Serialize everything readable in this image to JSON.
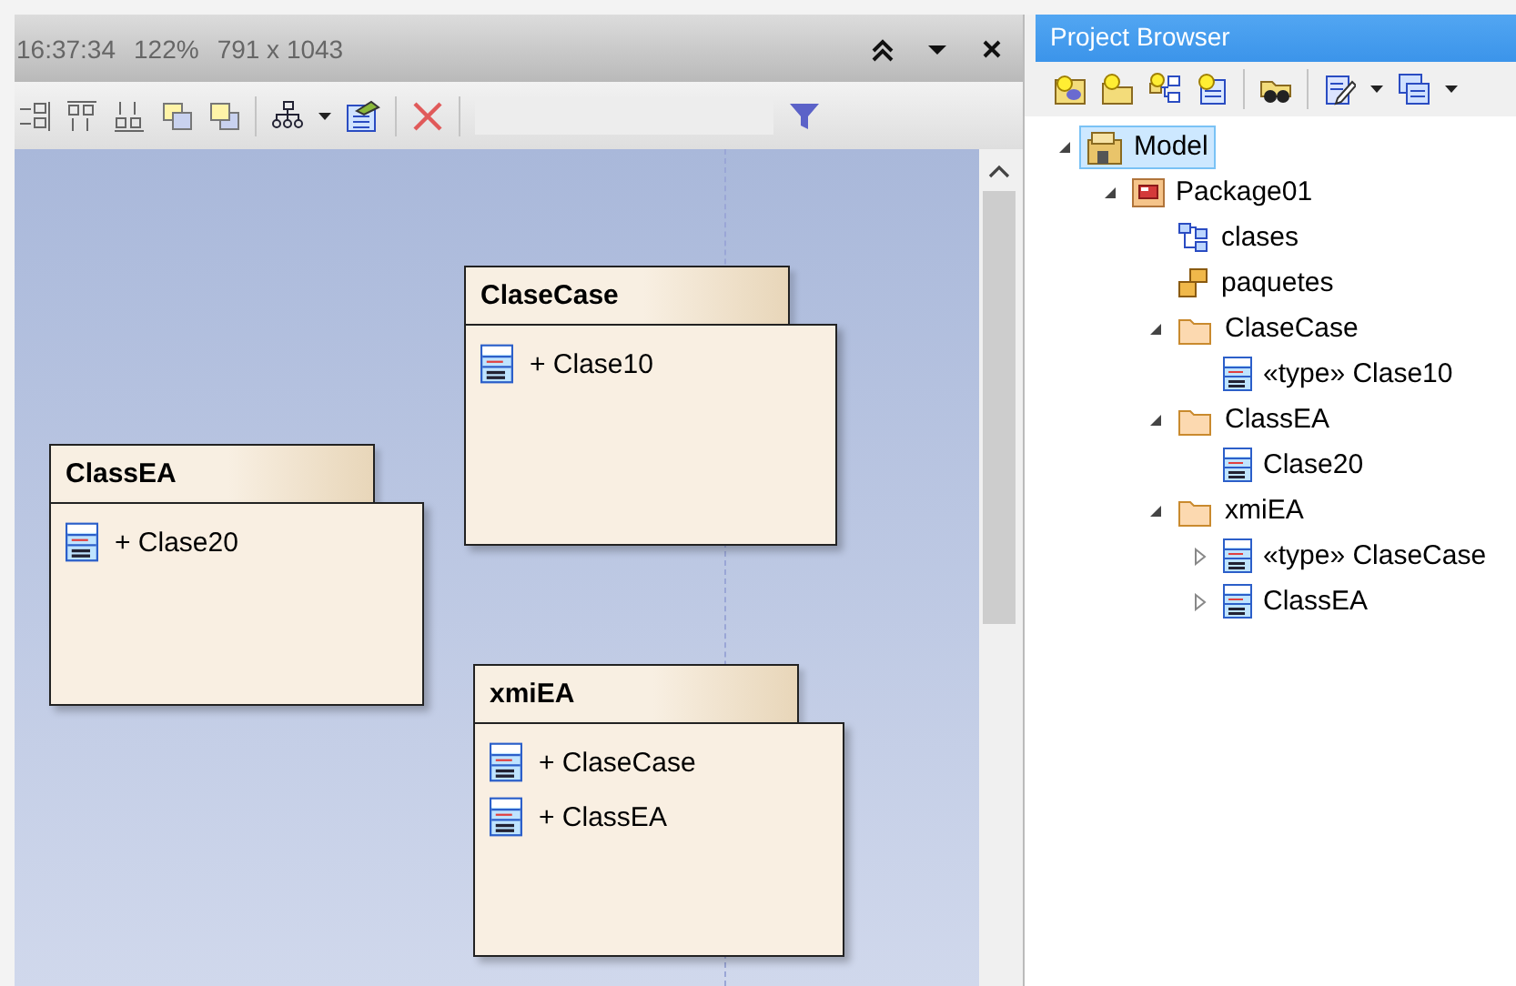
{
  "diagram": {
    "status": [
      "16:37:34",
      "122%",
      "791 x 1043"
    ],
    "packages": [
      {
        "name": "ClaseCase",
        "elements": [
          {
            "label": "+ Clase10"
          }
        ]
      },
      {
        "name": "ClassEA",
        "elements": [
          {
            "label": "+ Clase20"
          }
        ]
      },
      {
        "name": "xmiEA",
        "elements": [
          {
            "label": "+ ClaseCase"
          },
          {
            "label": "+ ClassEA"
          }
        ]
      }
    ]
  },
  "project_browser": {
    "title": "Project Browser",
    "tree": [
      {
        "label": "Model",
        "kind": "model",
        "expanded": true,
        "selected": true,
        "children": [
          {
            "label": "Package01",
            "kind": "package",
            "expanded": true,
            "selected": false,
            "children": [
              {
                "label": "clases",
                "kind": "diagram",
                "selected": false
              },
              {
                "label": "paquetes",
                "kind": "package-diagram",
                "selected": false
              },
              {
                "label": "ClaseCase",
                "kind": "folder",
                "expanded": true,
                "selected": false,
                "children": [
                  {
                    "label": "«type» Clase10",
                    "kind": "class",
                    "selected": false
                  }
                ]
              },
              {
                "label": "ClassEA",
                "kind": "folder",
                "expanded": true,
                "selected": false,
                "children": [
                  {
                    "label": "Clase20",
                    "kind": "class",
                    "selected": false
                  }
                ]
              },
              {
                "label": "xmiEA",
                "kind": "folder",
                "expanded": true,
                "selected": false,
                "children": [
                  {
                    "label": "«type» ClaseCase",
                    "kind": "class",
                    "expanded": false,
                    "selected": false
                  },
                  {
                    "label": "ClassEA",
                    "kind": "class",
                    "expanded": false,
                    "selected": false
                  }
                ]
              }
            ]
          }
        ]
      }
    ]
  }
}
